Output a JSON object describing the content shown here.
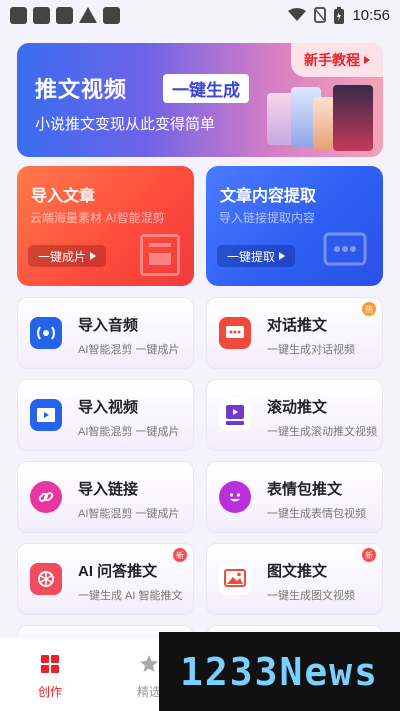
{
  "status_bar": {
    "time": "10:56"
  },
  "banner": {
    "title": "推文视频",
    "badge": "一键生成",
    "subtitle": "小说推文变现从此变得简单",
    "tutorial": "新手教程"
  },
  "feature_cards": [
    {
      "title": "导入文章",
      "subtitle": "云端海量素材 AI智能混剪",
      "button": "一键成片"
    },
    {
      "title": "文章内容提取",
      "subtitle": "导入链接提取内容",
      "button": "一键提取"
    }
  ],
  "tools": [
    {
      "title": "导入音频",
      "subtitle": "AI智能混剪 一键成片"
    },
    {
      "title": "对话推文",
      "subtitle": "一键生成对话视频",
      "badge": "热"
    },
    {
      "title": "导入视频",
      "subtitle": "AI智能混剪 一键成片"
    },
    {
      "title": "滚动推文",
      "subtitle": "一键生成滚动推文视频"
    },
    {
      "title": "导入链接",
      "subtitle": "AI智能混剪 一键成片"
    },
    {
      "title": "表情包推文",
      "subtitle": "一键生成表情包视频"
    },
    {
      "title": "AI 问答推文",
      "subtitle": "一键生成 AI 智能推文",
      "badge": "新"
    },
    {
      "title": "图文推文",
      "subtitle": "一键生成图文视频",
      "badge": "新"
    }
  ],
  "bottom_nav": [
    {
      "label": "创作",
      "active": true
    },
    {
      "label": "精选",
      "active": false
    }
  ],
  "watermark": "1233News",
  "colors": {
    "accent_red": "#e8232a",
    "accent_blue": "#2d5df2"
  }
}
